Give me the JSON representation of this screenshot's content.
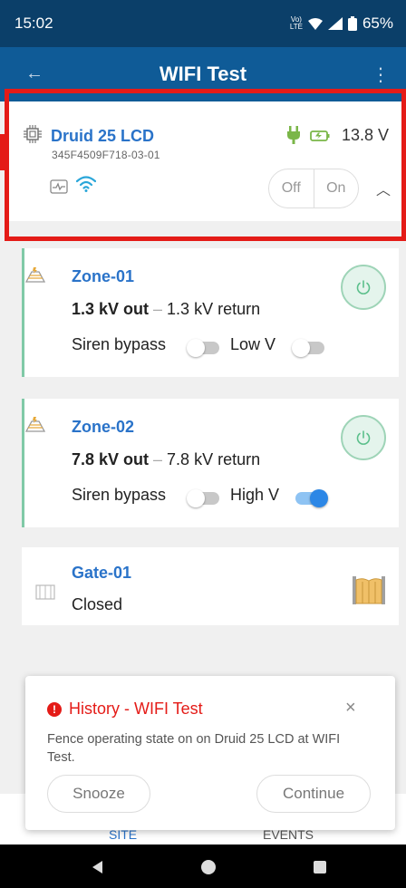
{
  "status_bar": {
    "time": "15:02",
    "network_top": "Vo)",
    "network_bottom": "LTE",
    "wifi_icon": "wifi-full-icon",
    "signal_icon": "signal-icon",
    "battery": "65%"
  },
  "app_bar": {
    "title": "WIFI Test",
    "back_icon": "back-arrow-icon",
    "menu_icon": "more-vert-icon"
  },
  "device": {
    "name": "Druid 25 LCD",
    "serial": "345F4509F718-03-01",
    "voltage": "13.8 V",
    "off_label": "Off",
    "on_label": "On",
    "icons": [
      "chip-icon",
      "plug-icon",
      "battery-charging-icon",
      "graph-icon",
      "wifi-icon",
      "chevron-up-icon"
    ]
  },
  "zones": [
    {
      "name": "Zone-01",
      "out": "1.3 kV out",
      "dash": "–",
      "return": "1.3 kV return",
      "siren_label": "Siren bypass",
      "siren_on": false,
      "volt_label": "Low V",
      "volt_on": false
    },
    {
      "name": "Zone-02",
      "out": "7.8 kV out",
      "dash": "–",
      "return": "7.8 kV return",
      "siren_label": "Siren bypass",
      "siren_on": false,
      "volt_label": "High V",
      "volt_on": true
    }
  ],
  "gate": {
    "name": "Gate-01",
    "status": "Closed"
  },
  "bottom_nav": {
    "site": "SITE",
    "events": "EVENTS"
  },
  "snackbar": {
    "title": "History - WIFI Test",
    "alert_glyph": "!",
    "close_glyph": "×",
    "message": "Fence operating state on on Druid 25 LCD at WIFI Test.",
    "snooze": "Snooze",
    "continue": "Continue"
  },
  "colors": {
    "status_bar": "#0b3f69",
    "app_bar": "#0f5b97",
    "accent": "#2a73c9",
    "highlight": "#e41b17",
    "zone_bar": "#80c9a7"
  }
}
